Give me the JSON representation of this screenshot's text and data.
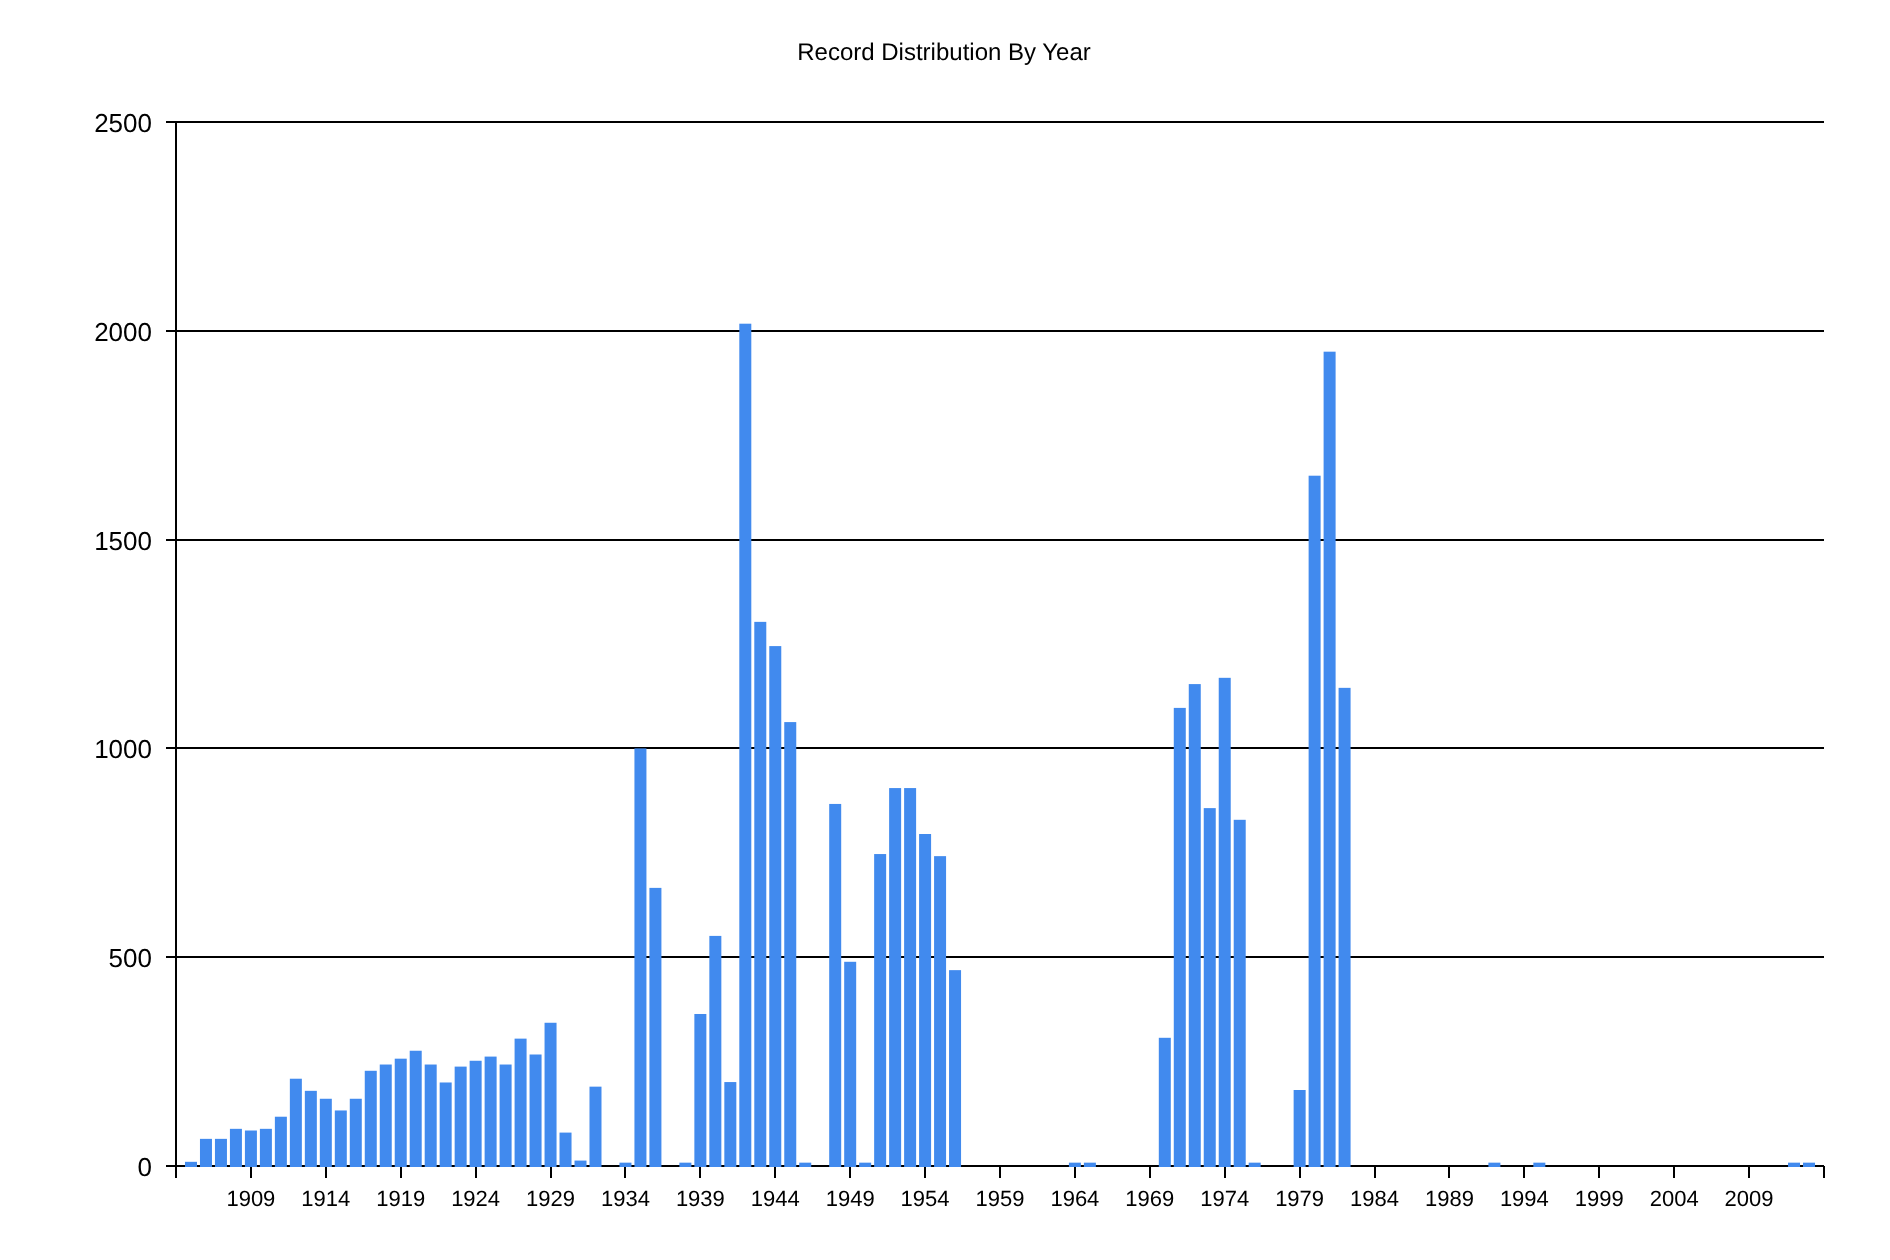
{
  "chart_data": {
    "type": "bar",
    "grid": true,
    "title": "Record Distribution By Year",
    "xlim": [
      1904,
      2014
    ],
    "ylim": [
      0,
      2500
    ],
    "xticks": [
      1909,
      1914,
      1919,
      1924,
      1929,
      1934,
      1939,
      1944,
      1949,
      1954,
      1959,
      1964,
      1969,
      1974,
      1979,
      1984,
      1989,
      1994,
      1999,
      2004,
      2009
    ],
    "yticks": [
      0,
      500,
      1000,
      1500,
      2000,
      2500
    ],
    "x": [
      1905,
      1906,
      1907,
      1908,
      1909,
      1910,
      1911,
      1912,
      1913,
      1914,
      1915,
      1916,
      1917,
      1918,
      1919,
      1920,
      1921,
      1922,
      1923,
      1924,
      1925,
      1926,
      1927,
      1928,
      1929,
      1930,
      1931,
      1932,
      1934,
      1935,
      1936,
      1938,
      1939,
      1940,
      1941,
      1942,
      1943,
      1944,
      1945,
      1946,
      1948,
      1949,
      1950,
      1951,
      1952,
      1953,
      1954,
      1955,
      1956,
      1964,
      1965,
      1970,
      1971,
      1972,
      1973,
      1974,
      1975,
      1976,
      1979,
      1980,
      1981,
      1982,
      1992,
      1995,
      2012,
      2013
    ],
    "series": [
      {
        "color": "#418aee",
        "values": [
          10,
          65,
          65,
          89,
          85,
          89,
          118,
          209,
          180,
          161,
          133,
          161,
          228,
          243,
          257,
          276,
          243,
          200,
          238,
          252,
          262,
          243,
          305,
          267,
          343,
          80,
          13,
          190,
          8,
          1000,
          666,
          8,
          364,
          551,
          201,
          2017,
          1303,
          1245,
          1063,
          8,
          867,
          489,
          8,
          747,
          905,
          905,
          795,
          742,
          469,
          8,
          8,
          307,
          1097,
          1154,
          857,
          1169,
          829,
          8,
          182,
          1653,
          1950,
          1145,
          8,
          8,
          8,
          8
        ]
      }
    ]
  }
}
